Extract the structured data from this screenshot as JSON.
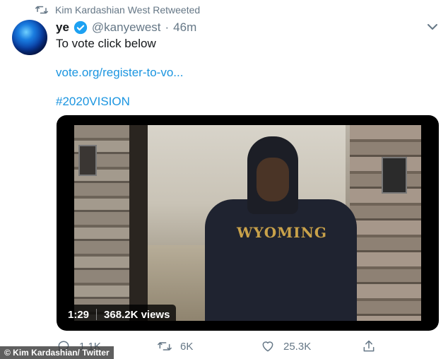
{
  "retweet_line": {
    "text": "Kim Kardashian West Retweeted"
  },
  "tweet": {
    "display_name": "ye",
    "handle": "@kanyewest",
    "separator": "·",
    "time": "46m",
    "text": "To vote click below",
    "link": "vote.org/register-to-vo...",
    "hashtag": "#2020VISION"
  },
  "video": {
    "duration": "1:29",
    "views": "368.2K views",
    "shirt_text": "WYOMING"
  },
  "actions": {
    "replies": "1.1K",
    "retweets": "6K",
    "likes": "25.3K"
  },
  "credit": {
    "text": "© Kim Kardashian/ Twitter"
  },
  "colors": {
    "accent": "#1b95e0",
    "muted": "#657786"
  }
}
